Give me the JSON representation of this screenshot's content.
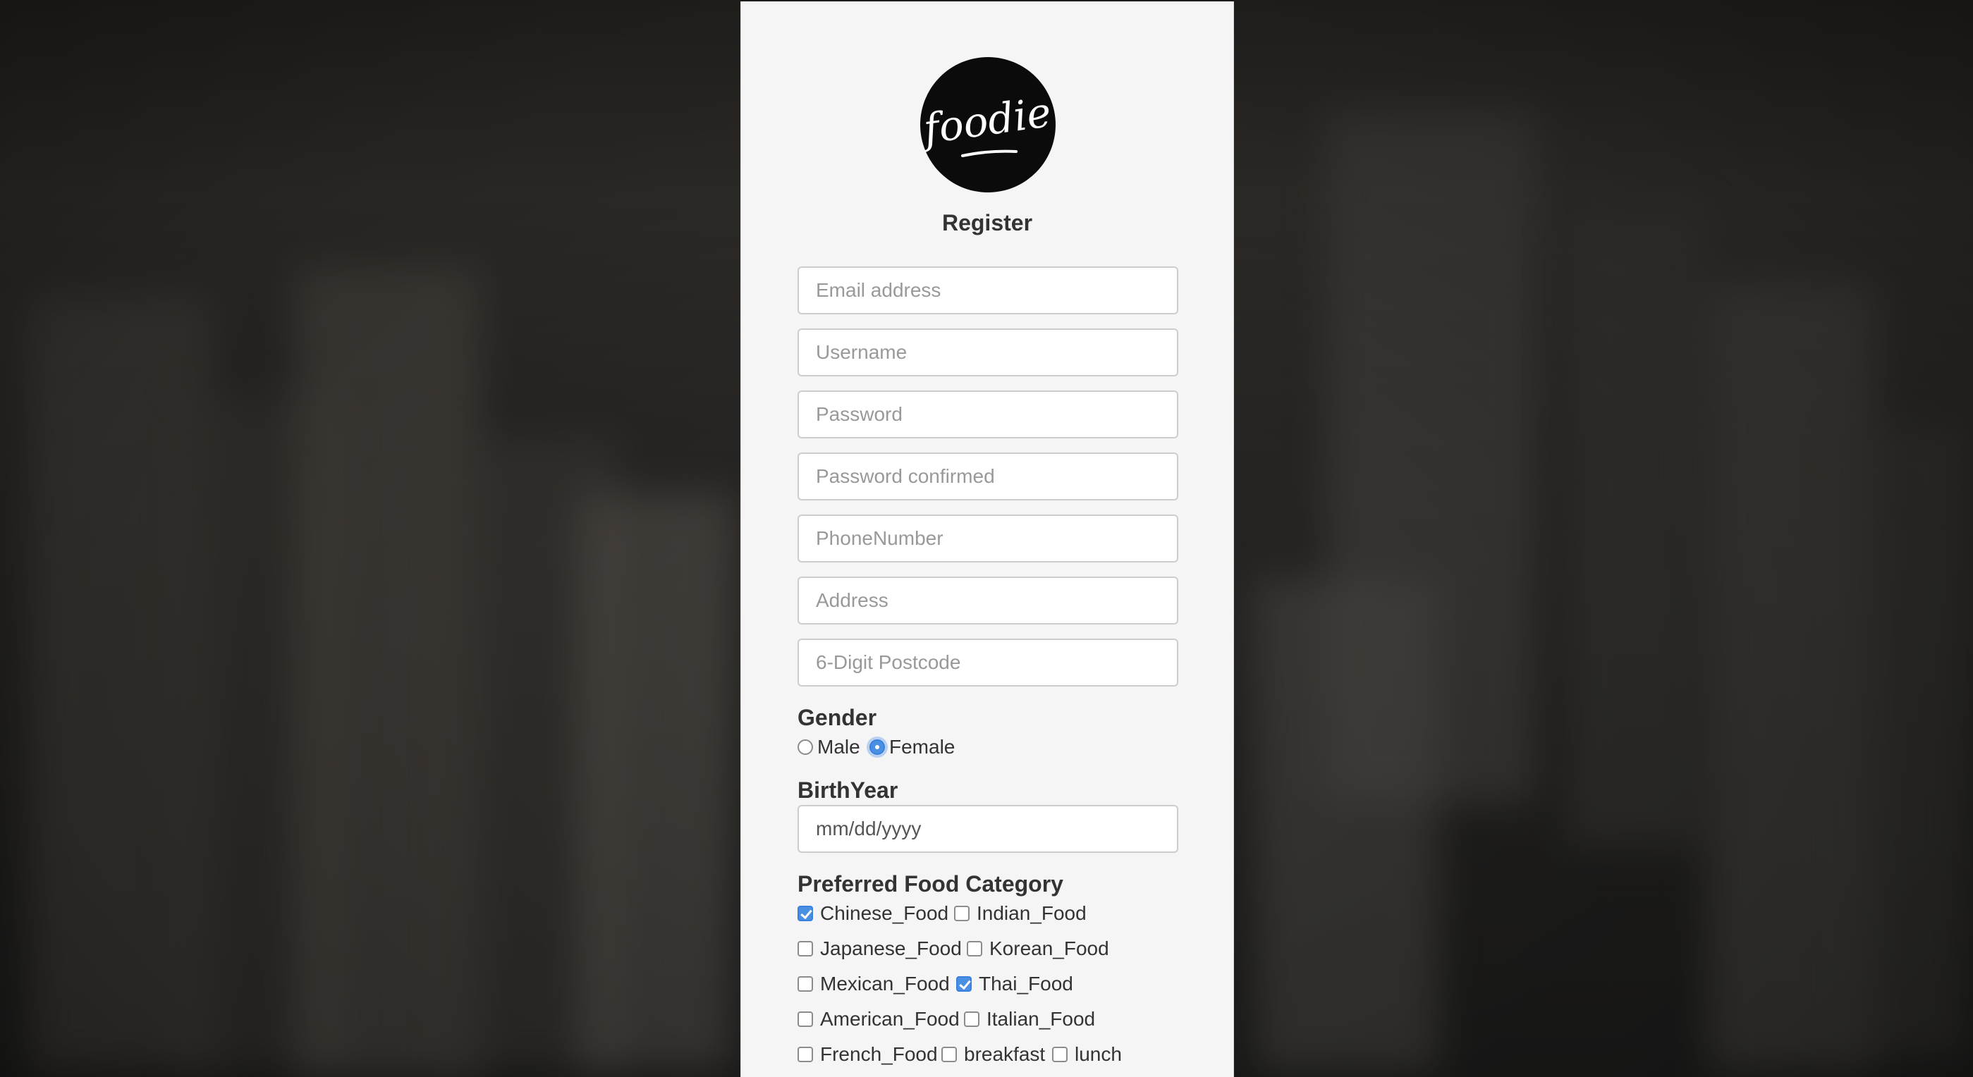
{
  "logo": {
    "text": "foodie",
    "icon": "foodie-logo"
  },
  "title": "Register",
  "fields": {
    "email": {
      "placeholder": "Email address",
      "value": ""
    },
    "username": {
      "placeholder": "Username",
      "value": ""
    },
    "password": {
      "placeholder": "Password",
      "value": ""
    },
    "password_confirm": {
      "placeholder": "Password confirmed",
      "value": ""
    },
    "phone": {
      "placeholder": "PhoneNumber",
      "value": ""
    },
    "address": {
      "placeholder": "Address",
      "value": ""
    },
    "postcode": {
      "placeholder": "6-Digit Postcode",
      "value": ""
    }
  },
  "gender": {
    "label": "Gender",
    "options": [
      {
        "label": "Male",
        "selected": false
      },
      {
        "label": "Female",
        "selected": true
      }
    ]
  },
  "birthyear": {
    "label": "BirthYear",
    "placeholder": "mm/dd/yyyy"
  },
  "food": {
    "label": "Preferred Food Category",
    "options": [
      {
        "label": "Chinese_Food",
        "checked": true
      },
      {
        "label": "Indian_Food",
        "checked": false
      },
      {
        "label": "Japanese_Food",
        "checked": false
      },
      {
        "label": "Korean_Food",
        "checked": false
      },
      {
        "label": "Mexican_Food",
        "checked": false
      },
      {
        "label": "Thai_Food",
        "checked": true
      },
      {
        "label": "American_Food",
        "checked": false
      },
      {
        "label": "Italian_Food",
        "checked": false
      },
      {
        "label": "French_Food",
        "checked": false
      },
      {
        "label": "breakfast",
        "checked": false
      },
      {
        "label": "lunch",
        "checked": false
      }
    ]
  },
  "colors": {
    "panel_bg": "#f5f5f5",
    "accent": "#4a90e2",
    "text": "#333333",
    "placeholder": "#999999"
  }
}
